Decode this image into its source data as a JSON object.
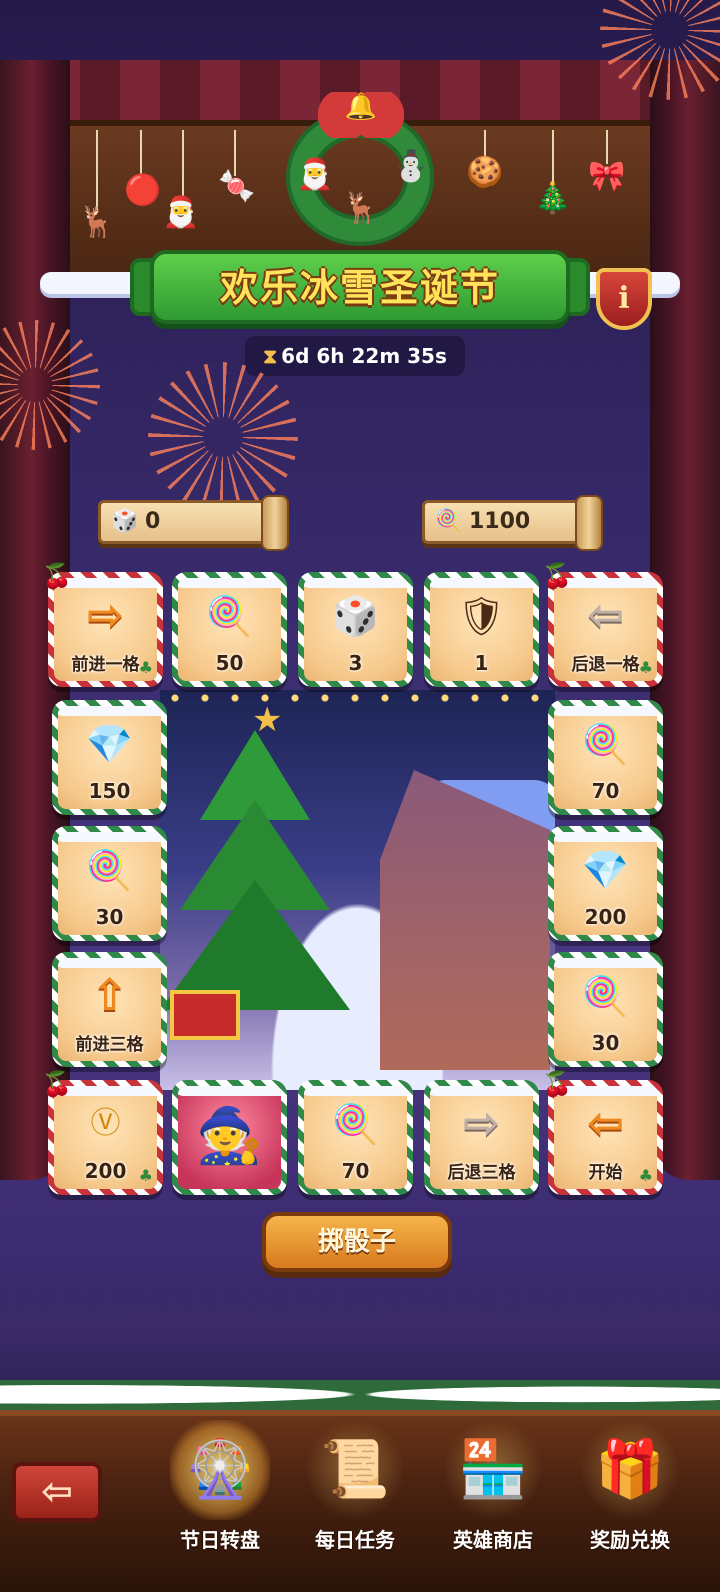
{
  "header": {
    "title": "欢乐冰雪圣诞节",
    "timer_icon": "hourglass-icon",
    "countdown": "6d 6h 22m 35s",
    "info_label": "i"
  },
  "counters": {
    "dice": {
      "icon": "dice-icon",
      "value": "0"
    },
    "candy": {
      "icon": "candy-cane-icon",
      "value": "1100"
    }
  },
  "board": {
    "tiles": [
      {
        "id": "t1",
        "icon": "arrow-right-icon",
        "label": "前进一格"
      },
      {
        "id": "t2",
        "icon": "candy-cane-icon",
        "label": "50"
      },
      {
        "id": "t3",
        "icon": "dice-icon",
        "label": "3"
      },
      {
        "id": "t4",
        "icon": "hero-helmet-icon",
        "label": "1"
      },
      {
        "id": "t5",
        "icon": "arrow-left-icon",
        "label": "后退一格"
      },
      {
        "id": "t6",
        "icon": "diamond-icon",
        "label": "150"
      },
      {
        "id": "t7",
        "icon": "candy-cane-icon",
        "label": "70"
      },
      {
        "id": "t8",
        "icon": "candy-cane-icon",
        "label": "30"
      },
      {
        "id": "t9",
        "icon": "diamond-icon",
        "label": "200"
      },
      {
        "id": "t10",
        "icon": "arrow-up-icon",
        "label": "前进三格"
      },
      {
        "id": "t11",
        "icon": "candy-cane-icon",
        "label": "30"
      },
      {
        "id": "t12",
        "icon": "vip-coin-icon",
        "label": "200"
      },
      {
        "id": "t13",
        "icon": "witch-hero-icon",
        "label": ""
      },
      {
        "id": "t14",
        "icon": "candy-cane-icon",
        "label": "70"
      },
      {
        "id": "t15",
        "icon": "arrow-right-icon",
        "label": "后退三格"
      },
      {
        "id": "t16",
        "icon": "arrow-left-icon",
        "label": "开始"
      }
    ]
  },
  "roll_button": {
    "label": "掷骰子"
  },
  "back_button": {
    "icon": "back-arrow-icon"
  },
  "nav": [
    {
      "label": "节日转盘",
      "icon": "festival-wheel-icon",
      "active": true
    },
    {
      "label": "每日任务",
      "icon": "scroll-quest-icon",
      "active": false
    },
    {
      "label": "英雄商店",
      "icon": "shop-icon",
      "active": false
    },
    {
      "label": "奖励兑换",
      "icon": "gift-box-icon",
      "active": false
    }
  ],
  "colors": {
    "banner_green": "#2f9a32",
    "title_yellow": "#ffe35a",
    "tile_cream": "#f6c98c",
    "roll_orange": "#e89430",
    "arrow_orange": "#f08a20"
  }
}
